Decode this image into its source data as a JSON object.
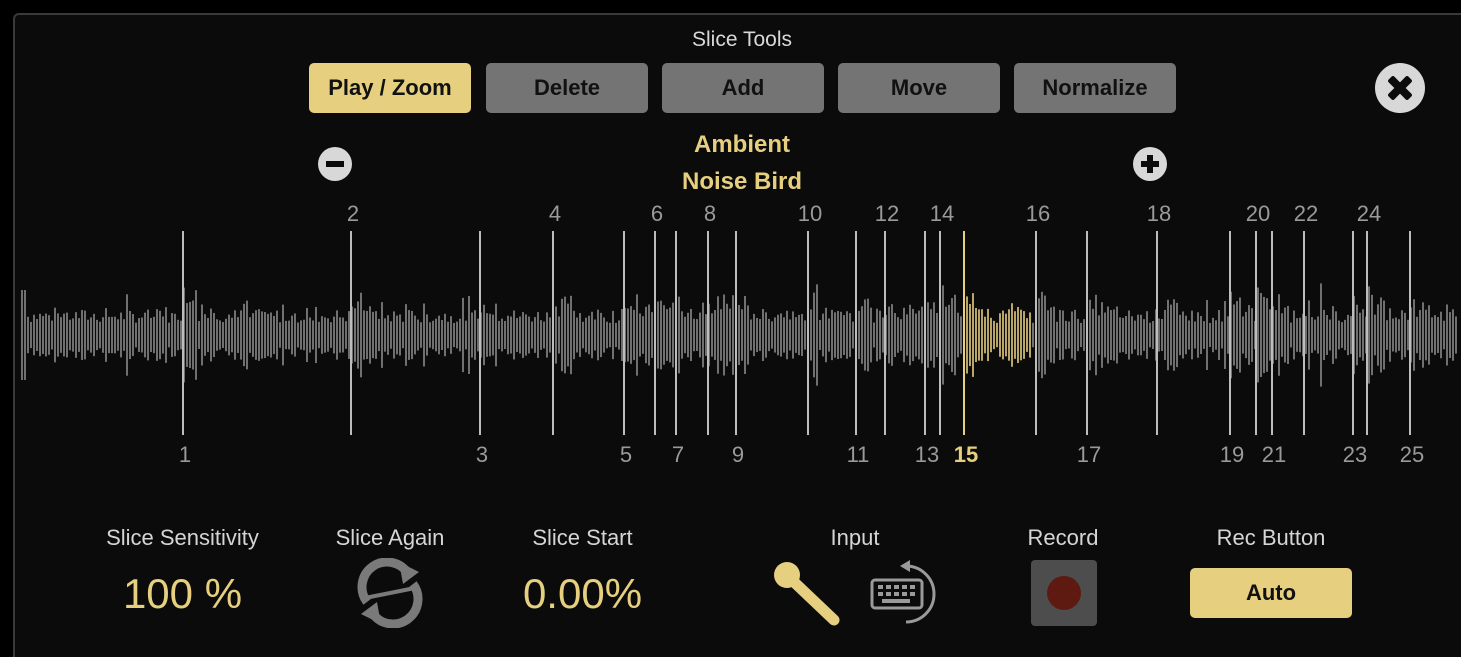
{
  "title": "Slice Tools",
  "toolbar": {
    "buttons": [
      {
        "label": "Play / Zoom",
        "active": true
      },
      {
        "label": "Delete",
        "active": false
      },
      {
        "label": "Add",
        "active": false
      },
      {
        "label": "Move",
        "active": false
      },
      {
        "label": "Normalize",
        "active": false
      }
    ]
  },
  "sample": {
    "line1": "Ambient",
    "line2": "Noise Bird"
  },
  "icons": {
    "close": "close-icon",
    "zoom_out": "minus-icon",
    "zoom_in": "plus-icon",
    "slice_again": "refresh-icon",
    "input_mic": "microphone-icon",
    "input_line": "keyboard-loop-icon",
    "record": "record-icon"
  },
  "slices": {
    "selected": 15,
    "labels": [
      "1",
      "2",
      "3",
      "4",
      "5",
      "6",
      "7",
      "8",
      "9",
      "10",
      "11",
      "12",
      "13",
      "14",
      "15",
      "16",
      "17",
      "18",
      "19",
      "20",
      "21",
      "22",
      "23",
      "24",
      "25"
    ]
  },
  "controls": {
    "slice_sensitivity": {
      "label": "Slice Sensitivity",
      "value": "100 %"
    },
    "slice_again": {
      "label": "Slice Again"
    },
    "slice_start": {
      "label": "Slice Start",
      "value": "0.00%"
    },
    "input": {
      "label": "Input"
    },
    "record": {
      "label": "Record"
    },
    "rec_button": {
      "label": "Rec Button",
      "value": "Auto"
    }
  },
  "colors": {
    "accent": "#e6cf7f",
    "button_gray": "#747474",
    "waveform": "#8a8a8a",
    "marker": "#bdbdbd",
    "background": "#0b0b0b",
    "record_dot": "#5e1a10"
  }
}
